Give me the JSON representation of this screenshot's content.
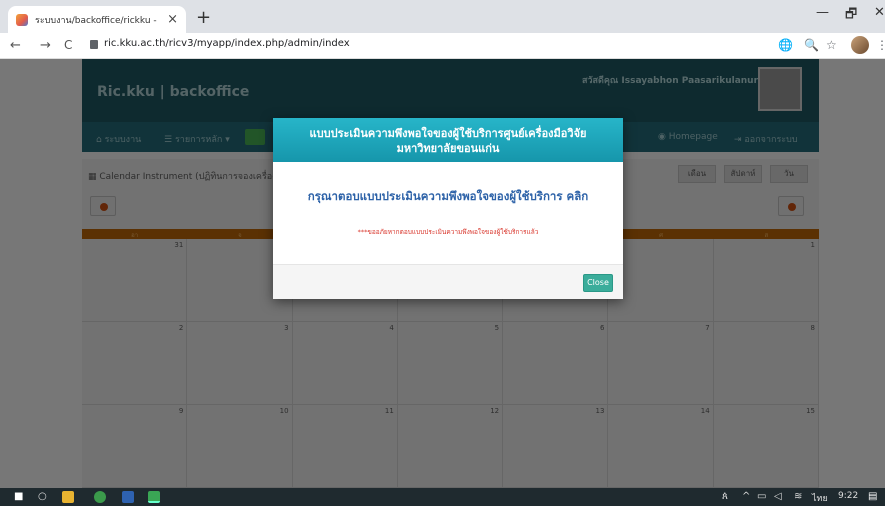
{
  "browser": {
    "tab_title": "ระบบงาน/backoffice/rickku -",
    "tab_close": "×",
    "new_tab": "+",
    "url": "ric.kku.ac.th/ricv3/myapp/index.php/admin/index",
    "back": "←",
    "forward": "→",
    "reload": "C",
    "minimize": "—",
    "restore": "🗗",
    "close": "✕",
    "star": "☆",
    "zoom": "🔍",
    "translate": "🌐",
    "menu": "⋮"
  },
  "header": {
    "brand": "Ric.kku | backoffice",
    "welcome": "สวัสดีคุณ Issayabhon Paasarikulanurn"
  },
  "navbar": {
    "items": [
      "ระบบงาน",
      "รายการหลัก",
      "Homepage",
      "ออกจากระบบ"
    ],
    "icons": [
      "home-icon",
      "list-icon",
      "eye-icon",
      "logout-icon"
    ]
  },
  "calendar": {
    "title": "Calendar Instrument (ปฏิทินการจองเครื่องมือ",
    "views": [
      "เดือน",
      "สัปดาห์",
      "วัน"
    ],
    "days": [
      "อา",
      "จ",
      "อ",
      "พ",
      "พฤ",
      "ศ",
      "ส"
    ],
    "weeks": [
      [
        "31",
        "",
        "",
        "",
        "",
        "",
        "1"
      ],
      [
        "2",
        "3",
        "4",
        "5",
        "6",
        "7",
        "8"
      ],
      [
        "9",
        "10",
        "11",
        "12",
        "13",
        "14",
        "15"
      ]
    ]
  },
  "modal": {
    "title_line1": "แบบประเมินความพึงพอใจของผู้ใช้บริการศูนย์เครื่องมือวิจัย",
    "title_line2": "มหาวิทยาลัยขอนแก่น",
    "link": "กรุณาตอบแบบประเมินความพึงพอใจของผู้ใช้บริการ คลิก",
    "note": "***ขออภัยหากตอบแบบประเมินความพึงพอใจของผู้ใช้บริการแล้ว",
    "close_label": "Close"
  },
  "taskbar": {
    "lang": "ไทย",
    "time": "9:22"
  },
  "colors": {
    "modal_header": "#1fa8bd",
    "close_button": "#3bad9b",
    "note_red": "#d9382e",
    "link_blue": "#2d62a8"
  }
}
